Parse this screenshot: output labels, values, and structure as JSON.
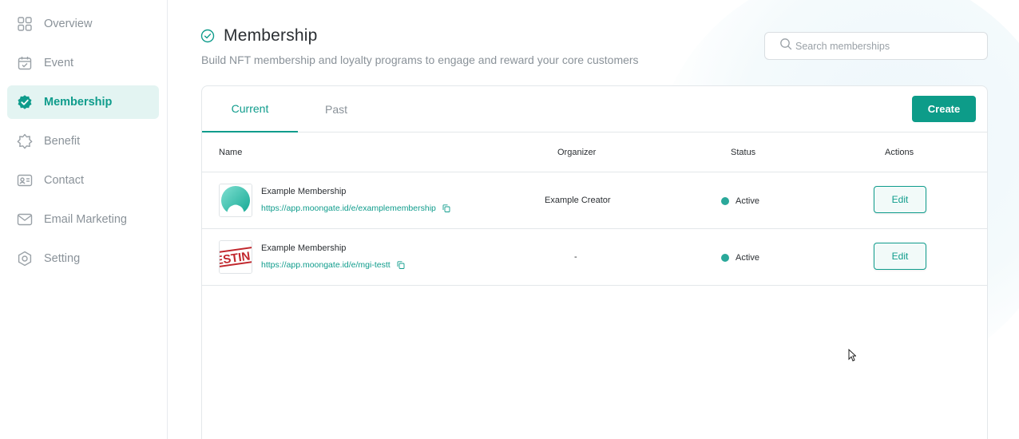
{
  "sidebar": {
    "items": [
      {
        "label": "Overview",
        "icon": "grid-icon",
        "active": false
      },
      {
        "label": "Event",
        "icon": "calendar-icon",
        "active": false
      },
      {
        "label": "Membership",
        "icon": "badge-check-icon",
        "active": true
      },
      {
        "label": "Benefit",
        "icon": "star-badge-icon",
        "active": false
      },
      {
        "label": "Contact",
        "icon": "contact-card-icon",
        "active": false
      },
      {
        "label": "Email Marketing",
        "icon": "mail-icon",
        "active": false
      },
      {
        "label": "Setting",
        "icon": "settings-icon",
        "active": false
      }
    ]
  },
  "header": {
    "title": "Membership",
    "subtitle": "Build NFT membership and loyalty programs to engage and reward your core customers"
  },
  "search": {
    "placeholder": "Search memberships",
    "value": ""
  },
  "tabs": [
    {
      "label": "Current",
      "active": true
    },
    {
      "label": "Past",
      "active": false
    }
  ],
  "create_label": "Create",
  "table": {
    "columns": [
      "Name",
      "Organizer",
      "Status",
      "Actions"
    ],
    "rows": [
      {
        "name": "Example Membership",
        "link": "https://app.moongate.id/e/examplemembership",
        "organizer": "Example Creator",
        "status": "Active",
        "action": "Edit",
        "thumb": "teal-gradient-logo"
      },
      {
        "name": "Example Membership",
        "link": "https://app.moongate.id/e/mgi-testt",
        "organizer": "-",
        "status": "Active",
        "action": "Edit",
        "thumb": "testing-stamp"
      }
    ]
  },
  "colors": {
    "accent": "#0f9c8c",
    "active_bg": "#e3f4f2",
    "status_dot": "#2aa89a",
    "muted_text": "#8a9299"
  }
}
